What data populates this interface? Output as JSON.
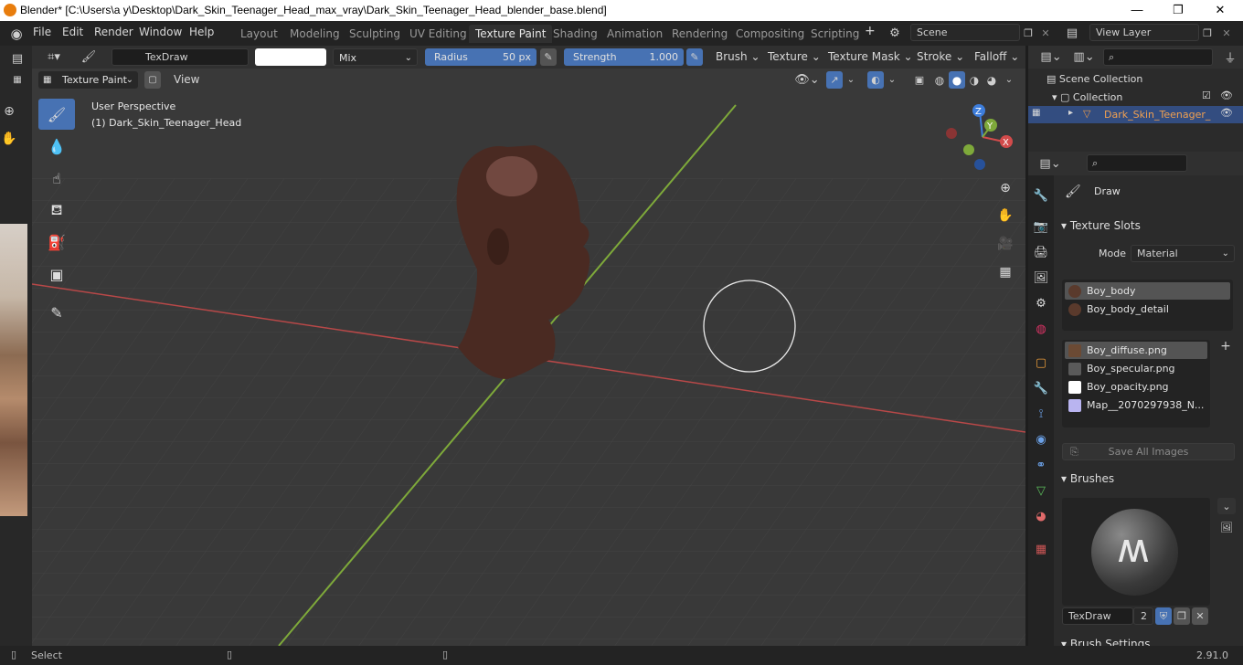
{
  "window": {
    "title": "Blender* [C:\\Users\\a y\\Desktop\\Dark_Skin_Teenager_Head_max_vray\\Dark_Skin_Teenager_Head_blender_base.blend]",
    "minimize": "—",
    "maximize": "❐",
    "close": "✕"
  },
  "menu": {
    "items": [
      "File",
      "Edit",
      "Render",
      "Window",
      "Help"
    ],
    "workspaces": [
      "Layout",
      "Modeling",
      "Sculpting",
      "UV Editing",
      "Texture Paint",
      "Shading",
      "Animation",
      "Rendering",
      "Compositing",
      "Scripting"
    ],
    "active_workspace": "Texture Paint",
    "add_workspace": "+",
    "scene": "Scene",
    "view_layer": "View Layer"
  },
  "tool_header": {
    "brush_name": "TexDraw",
    "blend_mode": "Mix",
    "radius_label": "Radius",
    "radius_value": "50 px",
    "strength_label": "Strength",
    "strength_value": "1.000",
    "brush_menu": "Brush",
    "texture_menu": "Texture",
    "texture_mask_menu": "Texture Mask",
    "stroke_menu": "Stroke",
    "falloff_menu": "Falloff"
  },
  "viewport_header": {
    "mode": "Texture Paint",
    "view_menu": "View"
  },
  "viewport": {
    "perspective": "User Perspective",
    "object_label": "(1) Dark_Skin_Teenager_Head",
    "gizmo": {
      "x": "X",
      "y": "Y",
      "z": "Z"
    }
  },
  "toolbar": {
    "tools": [
      "draw-brush-icon",
      "soften-icon",
      "smear-icon",
      "clone-icon",
      "fill-icon",
      "mask-icon",
      "annotate-icon"
    ]
  },
  "outliner": {
    "scene_collection": "Scene Collection",
    "collection": "Collection",
    "object": "Dark_Skin_Teenager_"
  },
  "properties": {
    "active_tool": "Draw",
    "texture_slots_header": "Texture Slots",
    "mode_label": "Mode",
    "mode_value": "Material",
    "materials": [
      "Boy_body",
      "Boy_body_detail"
    ],
    "images": [
      {
        "name": "Boy_diffuse.png",
        "color": "#6b4a34"
      },
      {
        "name": "Boy_specular.png",
        "color": "#5a5a5a"
      },
      {
        "name": "Boy_opacity.png",
        "color": "#ffffff"
      },
      {
        "name": "Map__2070297938_N...",
        "color": "#b9b4f0"
      }
    ],
    "save_all_images": "Save All Images",
    "brushes_header": "Brushes",
    "brush_name": "TexDraw",
    "brush_users": "2",
    "brush_settings_header": "Brush Settings"
  },
  "status": {
    "left": "Select",
    "version": "2.91.0"
  },
  "colors": {
    "accent": "#4772b3",
    "x_axis": "#d24b4b",
    "y_axis": "#7ea93a",
    "z_axis": "#3d7ddb"
  }
}
